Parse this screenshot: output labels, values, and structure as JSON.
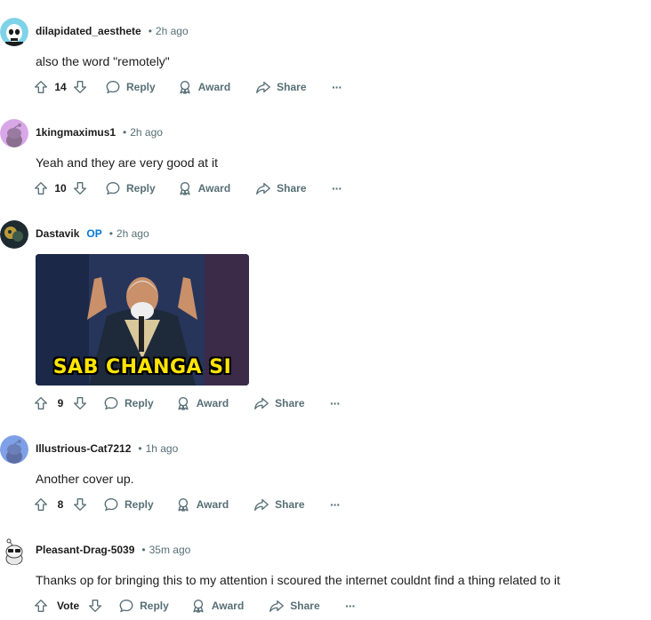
{
  "comments": [
    {
      "username": "dilapidated_aesthete",
      "sep": "•",
      "time": "2h ago",
      "text": "also the word \"remotely\"",
      "votes": "14",
      "reply": "Reply",
      "award": "Award",
      "share": "Share",
      "more": "···",
      "avatar_icon": "skeleton-avatar"
    },
    {
      "username": "1kingmaximus1",
      "sep": "•",
      "time": "2h ago",
      "text": "Yeah and they are very good at it",
      "votes": "10",
      "reply": "Reply",
      "award": "Award",
      "share": "Share",
      "more": "···",
      "avatar_icon": "snoo-avatar-purple"
    },
    {
      "username": "Dastavik",
      "op_badge": "OP",
      "sep": "•",
      "time": "2h ago",
      "image_caption": "SAB CHANGA SI",
      "votes": "9",
      "reply": "Reply",
      "award": "Award",
      "share": "Share",
      "more": "···",
      "avatar_icon": "photo-avatar"
    },
    {
      "username": "Illustrious-Cat7212",
      "sep": "•",
      "time": "1h ago",
      "text": "Another cover up.",
      "votes": "8",
      "reply": "Reply",
      "award": "Award",
      "share": "Share",
      "more": "···",
      "avatar_icon": "snoo-avatar-blue"
    },
    {
      "username": "Pleasant-Drag-5039",
      "sep": "•",
      "time": "35m ago",
      "text": "Thanks op for bringing this to my attention i scoured the internet couldnt find a thing related to it",
      "votes": "Vote",
      "reply": "Reply",
      "award": "Award",
      "share": "Share",
      "more": "···",
      "avatar_icon": "snoo-sunglasses-avatar"
    }
  ],
  "colors": {
    "meta_gray": "#576f76",
    "op_blue": "#0079d3",
    "caption_yellow": "#ffe500"
  }
}
